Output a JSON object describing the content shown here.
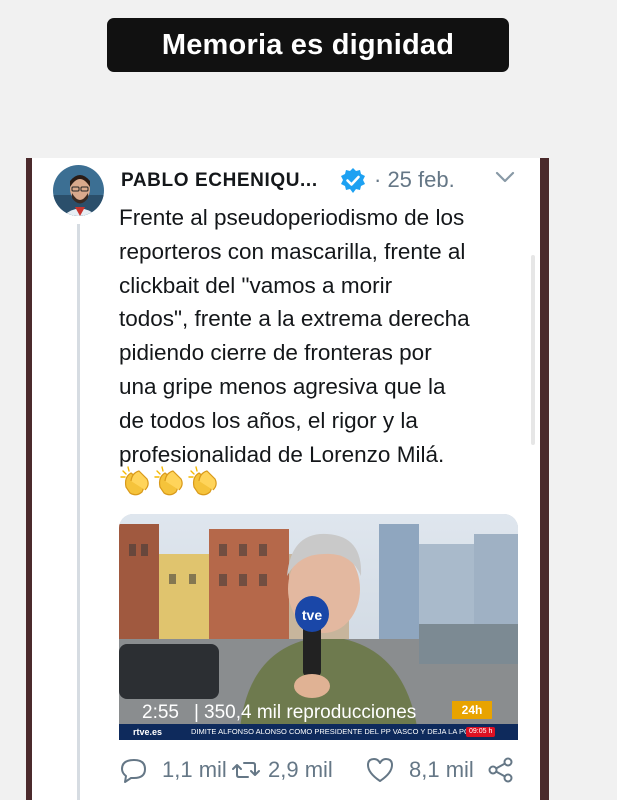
{
  "story": {
    "caption": "Memoria es dignidad"
  },
  "tweet": {
    "author": "PABLO ECHENIQU...",
    "date": "· 25 feb.",
    "text_lines": [
      "Frente al pseudoperiodismo de los",
      "reporteros con mascarilla, frente al",
      "clickbait del \"vamos a morir",
      "todos\", frente a la extrema derecha",
      "pidiendo cierre de fronteras por",
      "una gripe menos agresiva que la",
      "de todos los años, el rigor y la",
      "profesionalidad de Lorenzo Milá."
    ],
    "emoji_icons": [
      "clapping-hands-icon",
      "clapping-hands-icon",
      "clapping-hands-icon"
    ]
  },
  "video": {
    "duration": "2:55",
    "separator": "|",
    "views": "350,4 mil reproducciones",
    "badge": "24h",
    "mic_label": "tve",
    "ticker_logo": "rtve.es",
    "ticker_text": "DIMITE ALFONSO ALONSO COMO PRESIDENTE DEL PP VASCO Y DEJA LA PO",
    "ticker_time": "09:05 h"
  },
  "actions": {
    "replies": "1,1 mil",
    "retweets": "2,9 mil",
    "likes": "8,1 mil"
  },
  "colors": {
    "caption_bg": "#111111",
    "verified": "#1da1f2",
    "muted_text": "#657786",
    "frame_edge": "#4b2a2c"
  }
}
